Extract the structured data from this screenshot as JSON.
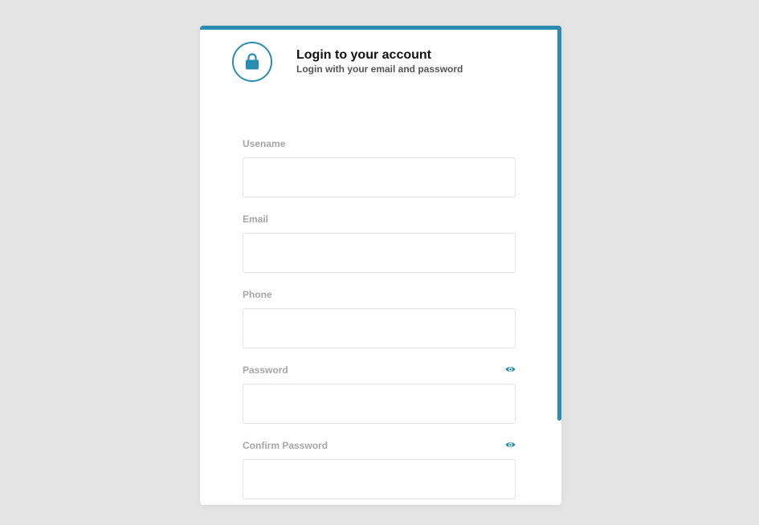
{
  "header": {
    "title": "Login to your account",
    "subtitle": "Login with your email and password",
    "icon": "lock-icon"
  },
  "form": {
    "fields": [
      {
        "label": "Usename",
        "value": "",
        "placeholder": ""
      },
      {
        "label": "Email",
        "value": "",
        "placeholder": ""
      },
      {
        "label": "Phone",
        "value": "",
        "placeholder": ""
      },
      {
        "label": "Password",
        "value": "",
        "placeholder": "",
        "toggle_icon": "eye-icon"
      },
      {
        "label": "Confirm Password",
        "value": "",
        "placeholder": "",
        "toggle_icon": "eye-icon"
      }
    ]
  },
  "colors": {
    "accent": "#2b8cb1",
    "background": "#e4e4e4",
    "label": "#a6a6a6"
  }
}
